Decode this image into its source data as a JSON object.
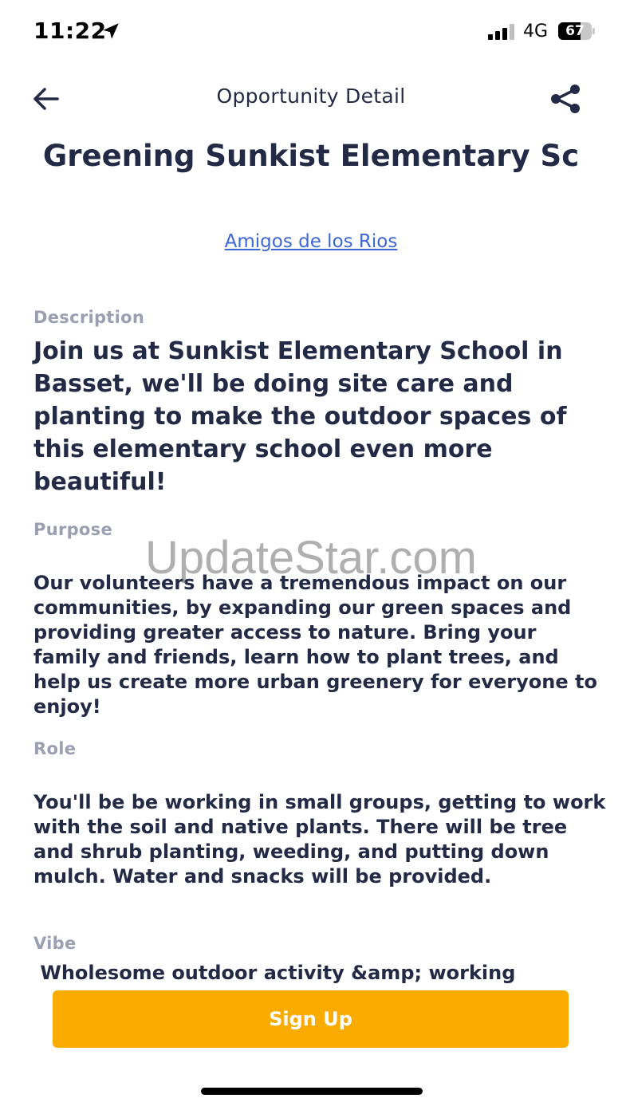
{
  "status_bar": {
    "time": "11:22",
    "network": "4G",
    "battery_level": "67",
    "battery_fraction": 0.67
  },
  "nav": {
    "title": "Opportunity Detail",
    "back_icon": "arrow-left-icon",
    "share_icon": "share-icon"
  },
  "opportunity": {
    "title": "Greening Sunkist Elementary Sc",
    "organization": "Amigos de los Rios"
  },
  "sections": {
    "description": {
      "label": "Description",
      "text": "Join us at Sunkist Elementary School in Basset, we'll be doing site care and planting to make the outdoor spaces of this elementary school even more beautiful!"
    },
    "purpose": {
      "label": "Purpose",
      "text": "Our volunteers have a tremendous impact on our communities, by expanding our green spaces and providing greater access to nature. Bring your family and friends, learn how to plant trees, and help us create more urban greenery for everyone to enjoy!"
    },
    "role": {
      "label": "Role",
      "text": "You'll be be working in small groups, getting to work with the soil and native plants. There will be tree and shrub planting, weeding, and putting down mulch. Water and snacks will be provided."
    },
    "vibe": {
      "label": "Vibe",
      "text": " Wholesome outdoor activity &amp; working"
    }
  },
  "watermark": "UpdateStar.com",
  "actions": {
    "sign_up_label": "Sign Up"
  },
  "colors": {
    "accent": "#f9ab00",
    "link": "#3c67d4",
    "heading": "#232a45",
    "muted_label": "#9aa0b2"
  }
}
